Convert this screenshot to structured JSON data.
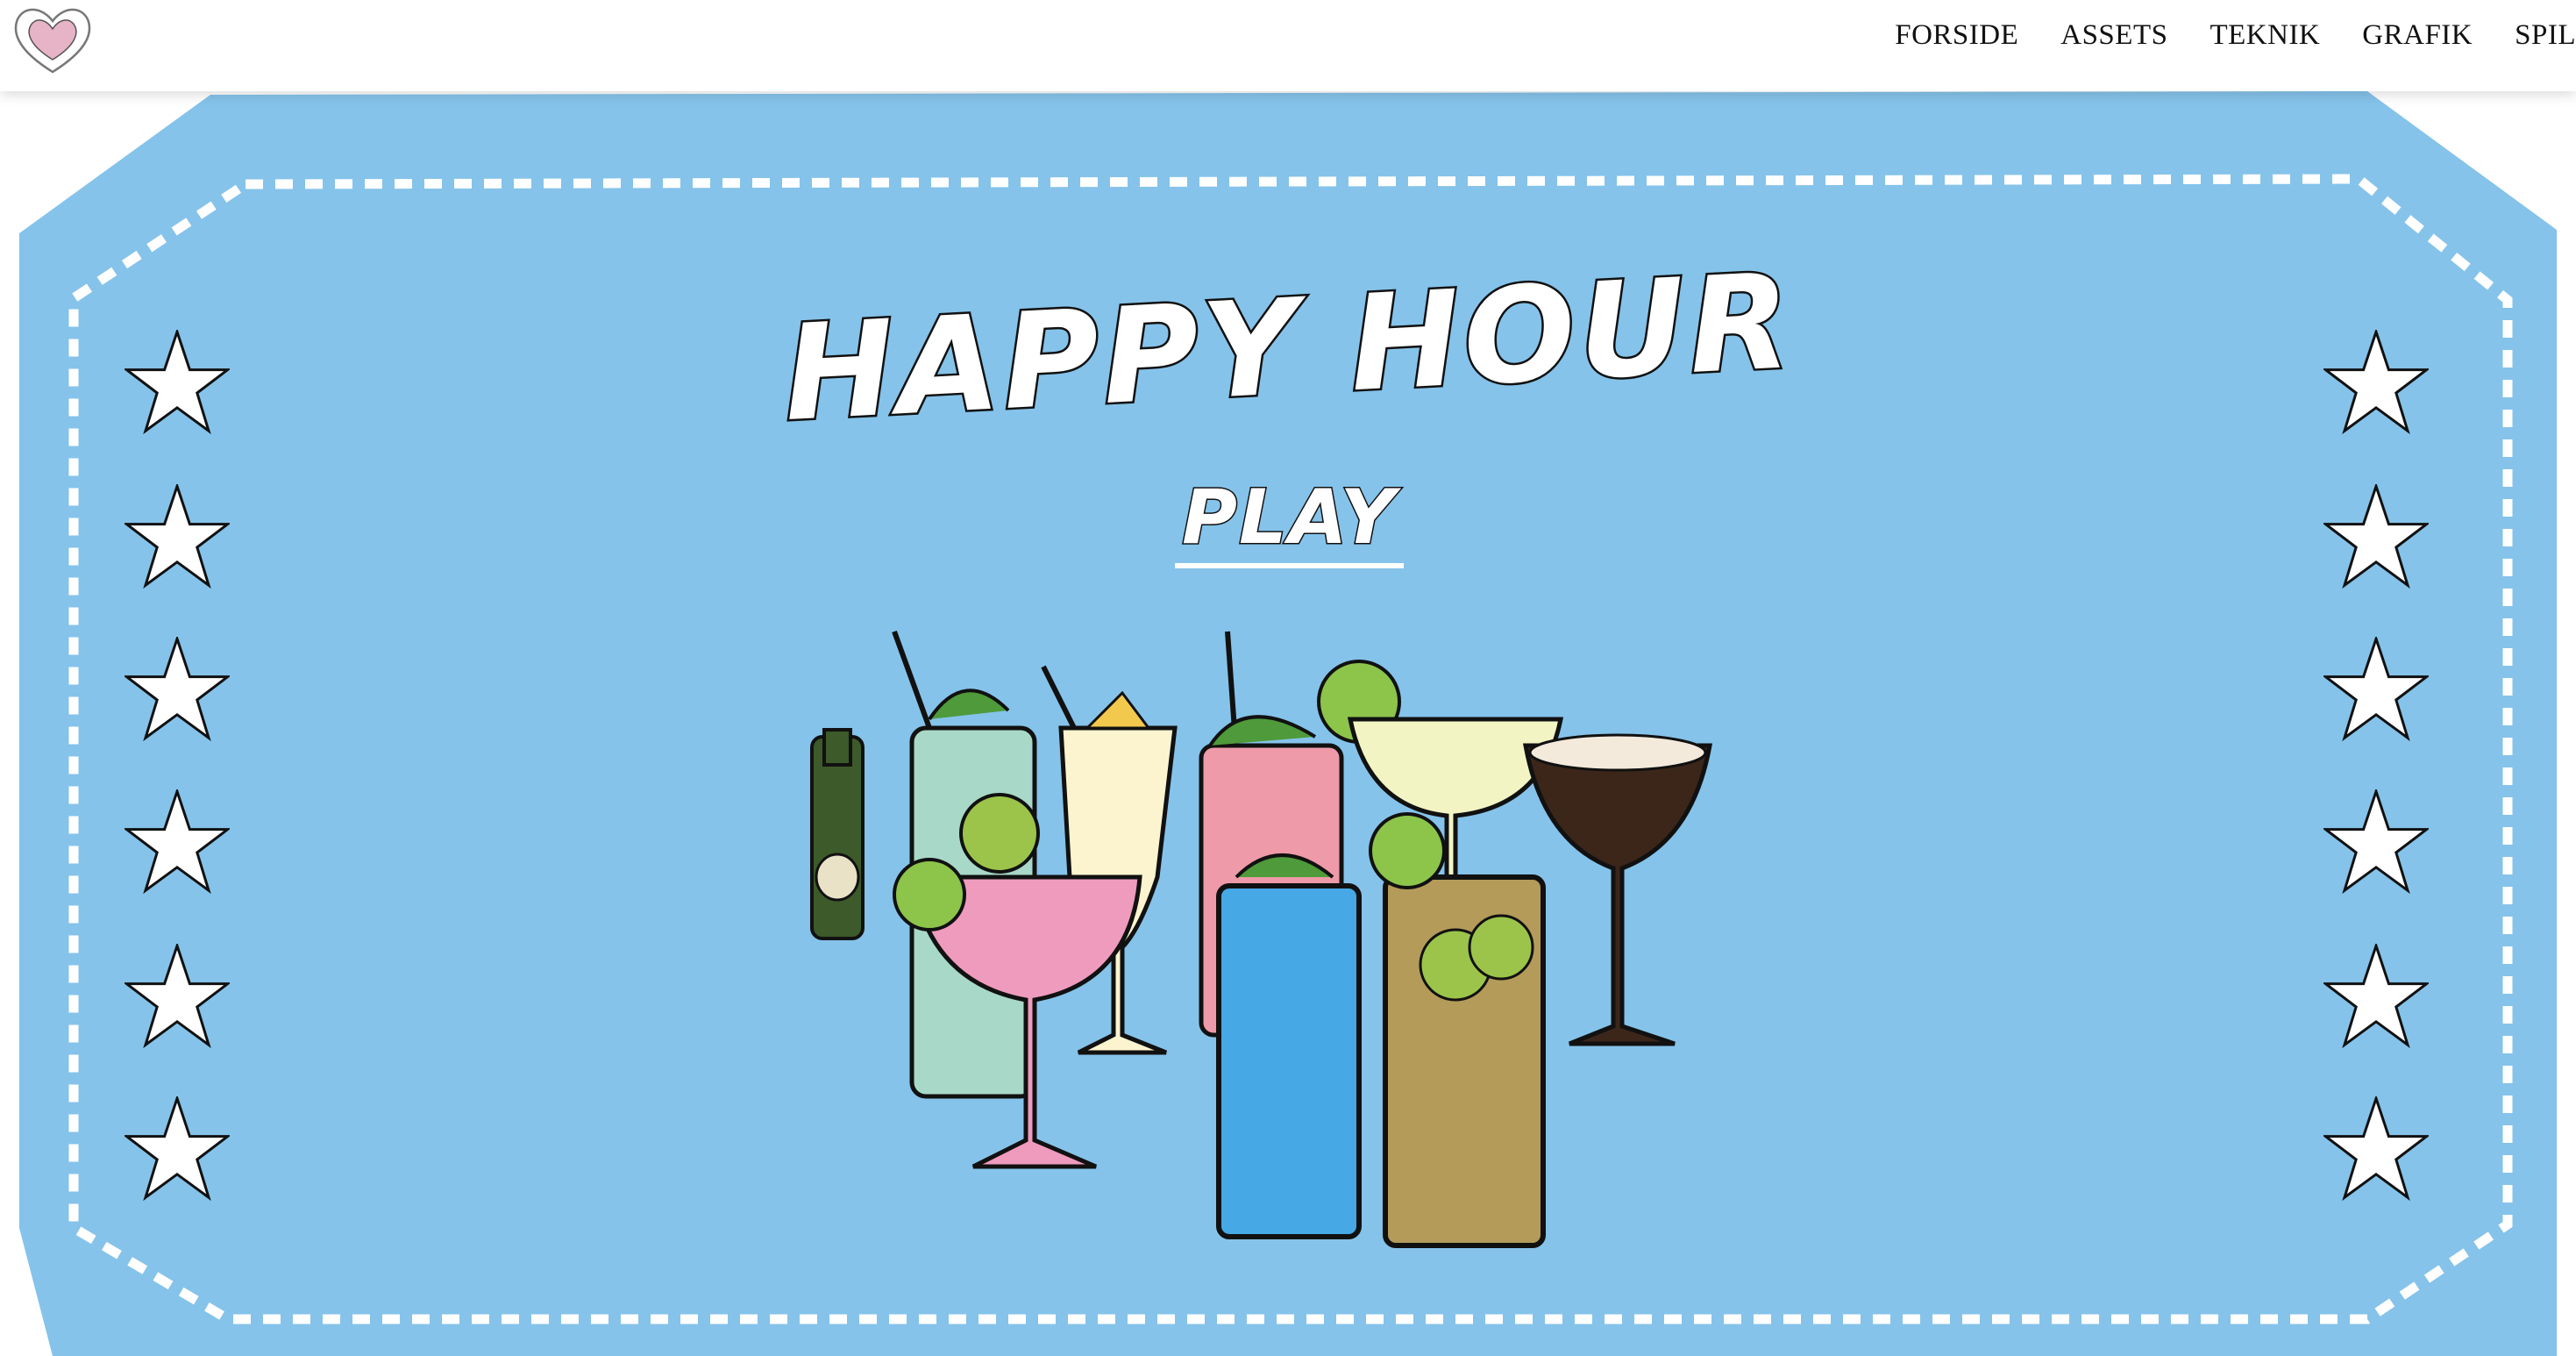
{
  "nav": {
    "items": [
      "FORSIDE",
      "ASSETS",
      "TEKNIK",
      "GRAFIK",
      "SPIL"
    ]
  },
  "hero": {
    "title": "HAPPY HOUR",
    "play_label": "PLAY"
  },
  "icons": {
    "logo": "heart-icon",
    "star": "star-icon",
    "illustration": "cocktail-glasses"
  },
  "colors": {
    "ticket_blue": "#85c3ea",
    "dash_white": "#ffffff",
    "text_dark": "#111111"
  }
}
